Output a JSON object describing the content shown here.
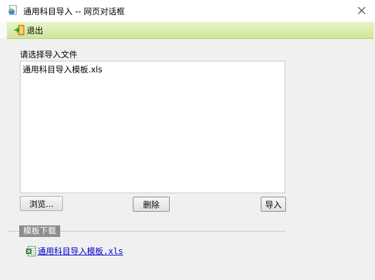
{
  "window": {
    "title": "通用科目导入 -- 网页对话框",
    "title_icon": "ie-page-icon",
    "close_icon": "close-icon"
  },
  "toolbar": {
    "exit_label": "退出",
    "exit_icon": "exit-door-icon"
  },
  "file_section": {
    "label": "请选择导入文件",
    "files": [
      "通用科目导入模板.xls"
    ]
  },
  "buttons": {
    "browse": "浏览...",
    "delete": "删除",
    "import": "导入"
  },
  "template_section": {
    "legend": "模板下载",
    "link_text": "通用科目导入模板.xls",
    "link_icon": "excel-file-icon"
  },
  "colors": {
    "toolbar_green": "#cfe59a",
    "link_blue": "#0000cc",
    "legend_gray": "#8d8d8d"
  }
}
